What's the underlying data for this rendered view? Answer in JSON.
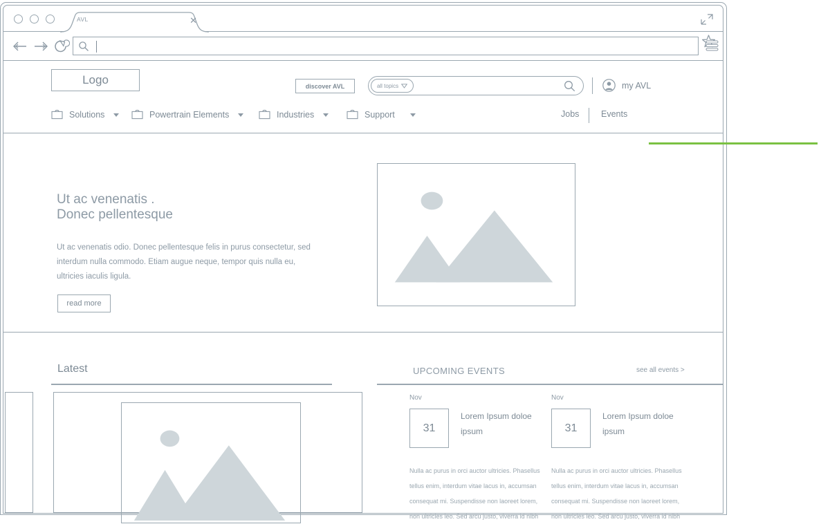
{
  "browser": {
    "tab": {
      "title": "AVL",
      "close_icon": "close-icon"
    },
    "traffic_lights": [
      "close",
      "minimize",
      "maximize"
    ],
    "restore_icon": "restore-window-icon",
    "toolbar": {
      "back_icon": "back-arrow-icon",
      "forward_icon": "forward-arrow-icon",
      "reload_icon": "reload-icon",
      "search_icon": "search-icon",
      "address_value": "",
      "address_placeholder": "",
      "bookmark_icon": "star-icon",
      "menu_icon": "hamburger-menu-icon"
    }
  },
  "site": {
    "logo": "Logo",
    "discover_button": "discover AVL",
    "search": {
      "topics_label": "all topics",
      "topics_caret_icon": "chevron-down-icon",
      "input_value": "",
      "input_placeholder": "",
      "search_icon": "search-icon"
    },
    "account": {
      "label": "my AVL",
      "avatar_icon": "user-avatar-icon"
    },
    "nav": [
      {
        "label": "Solutions",
        "icon": "briefcase-icon",
        "has_caret": true
      },
      {
        "label": "Powertrain Elements",
        "icon": "briefcase-icon",
        "has_caret": true
      },
      {
        "label": "Industries",
        "icon": "briefcase-icon",
        "has_caret": true
      },
      {
        "label": "Support",
        "icon": "briefcase-icon",
        "has_caret": true
      }
    ],
    "nav_right": [
      {
        "label": "Jobs"
      },
      {
        "label": "Events"
      }
    ]
  },
  "hero": {
    "title_line1": "Ut ac venenatis .",
    "title_line2": "Donec pellentesque",
    "body": "Ut ac venenatis odio. Donec pellentesque felis in purus consectetur, sed interdum nulla commodo. Etiam augue neque, tempor quis nulla eu, ultricies iaculis ligula.",
    "read_more": "read more",
    "image_placeholder_icon": "image-placeholder-icon"
  },
  "latest": {
    "heading": "Latest",
    "card_image_icon": "image-placeholder-icon"
  },
  "events": {
    "heading": "UPCOMING EVENTS",
    "see_all": "see all events >",
    "items": [
      {
        "month": "Nov",
        "day": "31",
        "title": "Lorem Ipsum doloe ipsum",
        "body": "Nulla ac purus in orci auctor ultricies. Phasellus tellus enim, interdum vitae lacus in, accumsan consequat mi. Suspendisse non laoreet lorem, non ultricies leo. Sed arcu justo, viverra id nibh"
      },
      {
        "month": "Nov",
        "day": "31",
        "title": "Lorem Ipsum doloe ipsum",
        "body": "Nulla ac purus in orci auctor ultricies. Phasellus tellus enim, interdum vitae lacus in, accumsan consequat mi. Suspendisse non laoreet lorem, non ultricies leo. Sed arcu justo, viverra id nibh"
      }
    ]
  },
  "annotation": {
    "green_line_color": "#7AC142"
  },
  "colors": {
    "outline": "#9aa7b0",
    "text": "#7d8a95",
    "muted_text": "#8d9aa5",
    "placeholder_fill": "#ced6da",
    "accent_green": "#7AC142"
  }
}
